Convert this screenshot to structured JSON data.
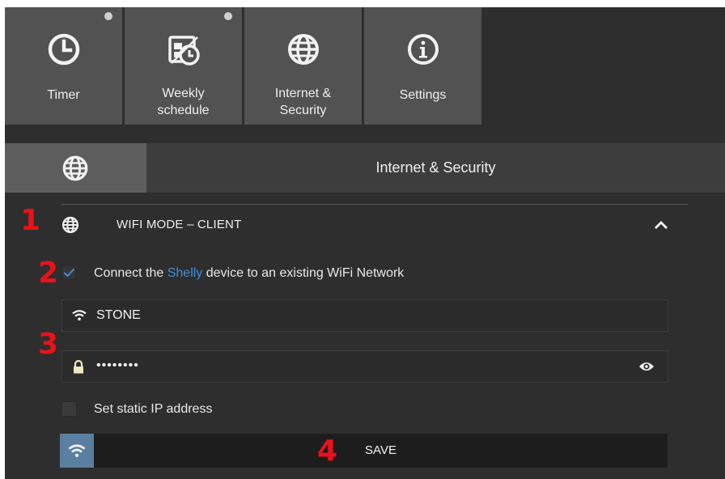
{
  "tiles": [
    {
      "label": "Timer",
      "icon": "clock-icon",
      "has_dot": true
    },
    {
      "label": "Weekly\nschedule",
      "icon": "schedule-icon",
      "has_dot": true
    },
    {
      "label": "Internet &\nSecurity",
      "icon": "globe-icon",
      "has_dot": false
    },
    {
      "label": "Settings",
      "icon": "info-icon",
      "has_dot": false
    }
  ],
  "section": {
    "title": "Internet & Security",
    "icon": "globe-icon"
  },
  "wifi_mode": {
    "title": "WIFI MODE – CLIENT",
    "expanded": true
  },
  "connect": {
    "prefix": "Connect the ",
    "brand": "Shelly",
    "suffix": " device to an existing WiFi Network",
    "checked": true
  },
  "ssid": {
    "value": "STONE"
  },
  "password": {
    "value": "••••••••"
  },
  "static_ip": {
    "label": "Set static IP address",
    "checked": false
  },
  "save": {
    "label": "SAVE"
  },
  "annotations": [
    "1",
    "2",
    "3",
    "4"
  ],
  "colors": {
    "brand": "#3d8fd9",
    "annotation": "#e8121a",
    "save_icon_bg": "#5a7fa0"
  }
}
